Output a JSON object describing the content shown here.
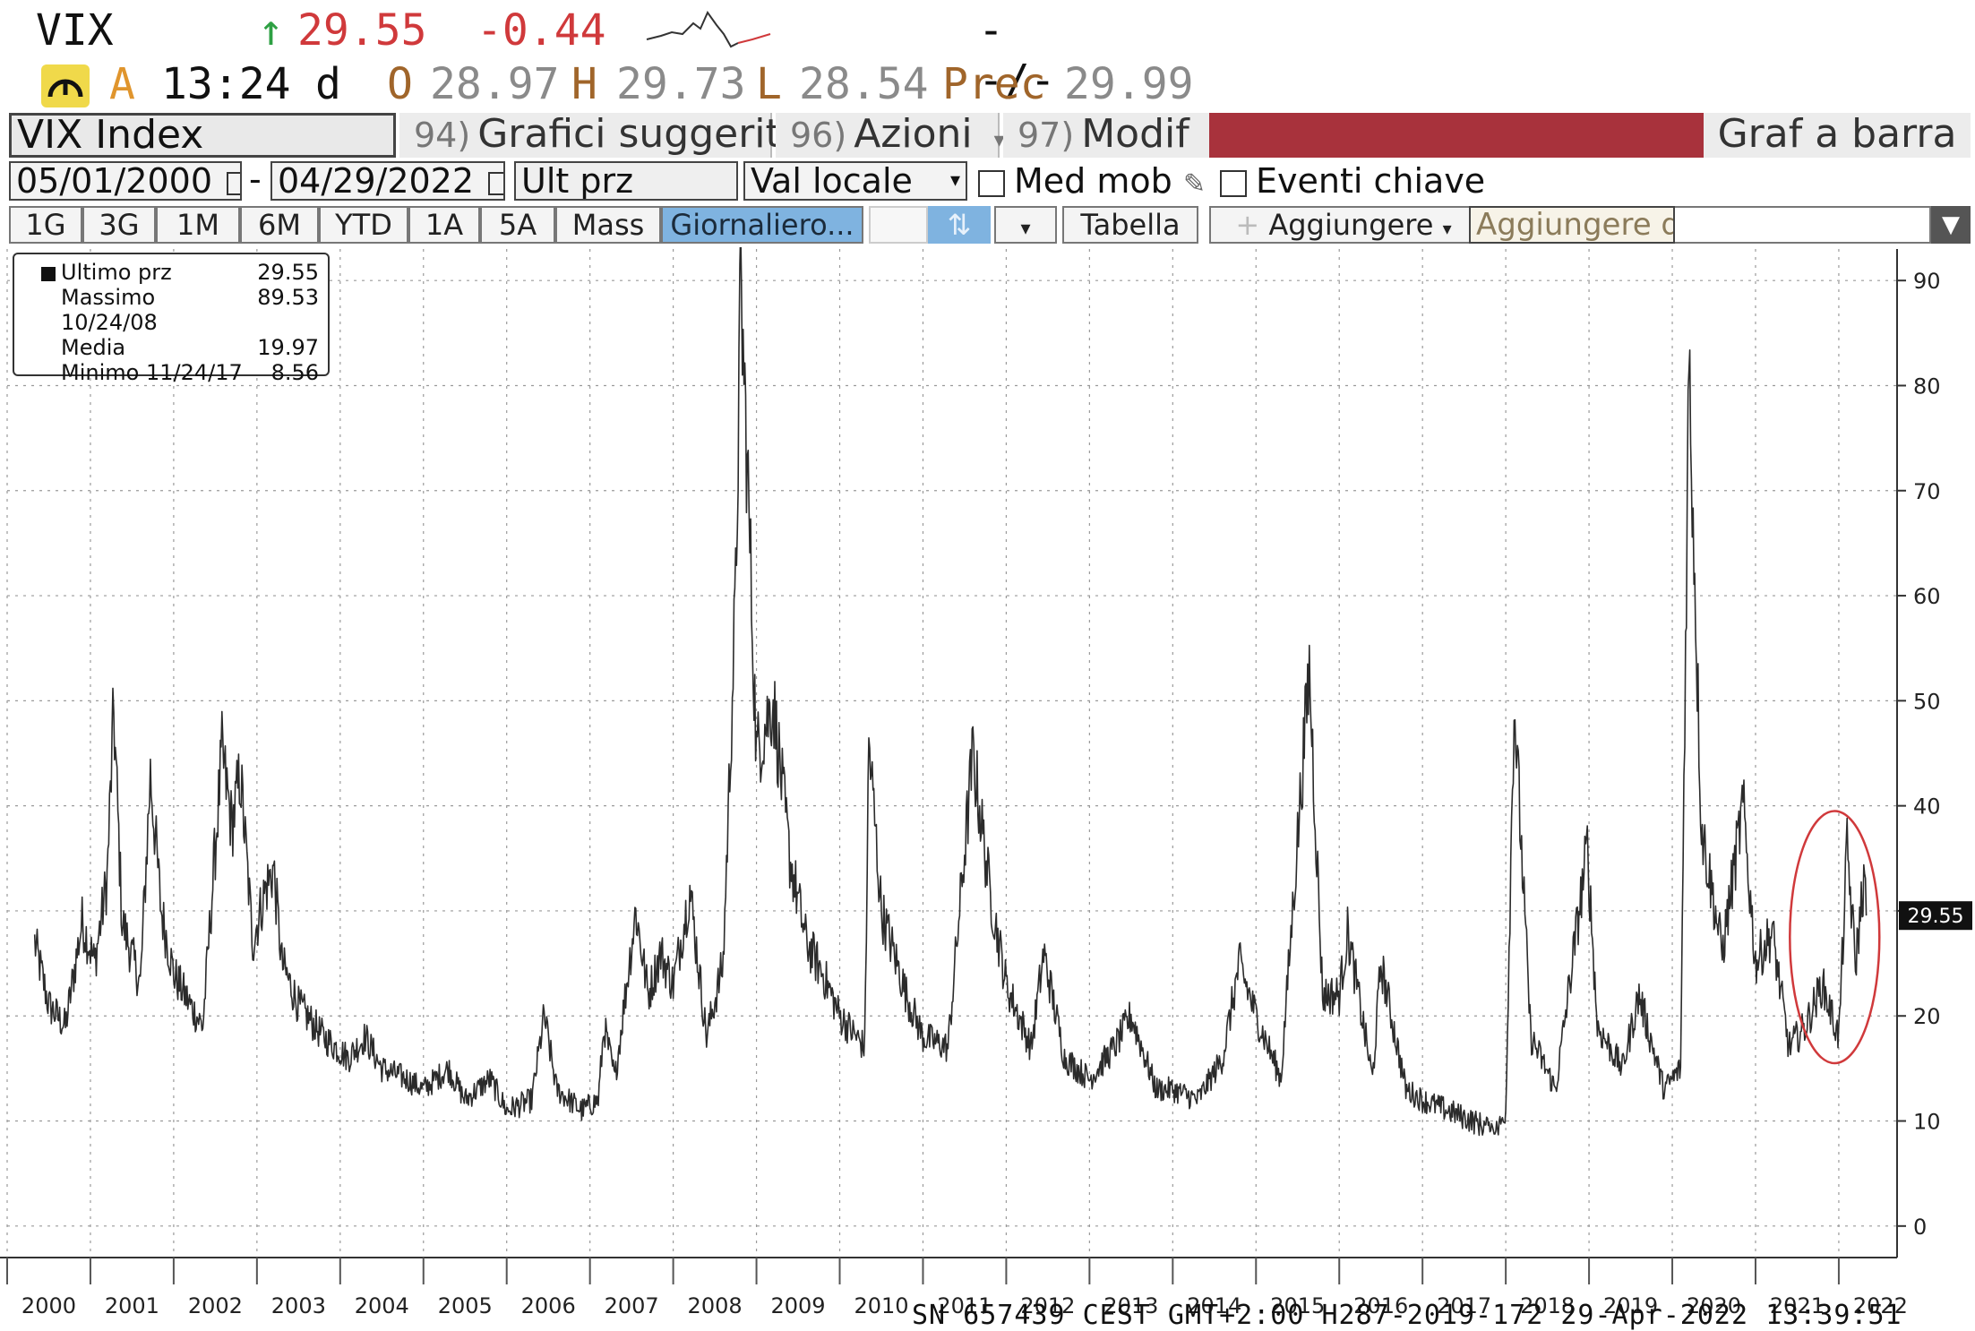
{
  "header": {
    "ticker": "VIX",
    "arrow": "↑",
    "last": "29.55",
    "change": "-0.44",
    "dash": "--/--",
    "quote_letter": "A",
    "time": "13:24",
    "time_suffix": "d",
    "open_label": "O",
    "open": "28.97",
    "high_label": "H",
    "high": "29.73",
    "low_label": "L",
    "low": "28.54",
    "prev_label": "Prec",
    "prev": "29.99"
  },
  "toolbar": {
    "security": "VIX Index",
    "tabs": [
      {
        "num": "94)",
        "label": "Grafici suggeriti"
      },
      {
        "num": "96)",
        "label": "Azioni",
        "arrow": "▾"
      },
      {
        "num": "97)",
        "label": "Modif",
        "arrow": "▾"
      }
    ],
    "chart_type": "Graf a barra",
    "start_date": "05/01/2000",
    "separator": "-",
    "end_date": "04/29/2022",
    "field": "Ult prz",
    "currency": "Val locale",
    "moving_avg": "Med mob",
    "key_events": "Eventi chiave",
    "periods": [
      "1G",
      "3G",
      "1M",
      "6M",
      "YTD",
      "1A",
      "5A",
      "Mass"
    ],
    "frequency": "Giornaliero...",
    "table": "Tabella",
    "add": "Aggiungere",
    "add_input": "Aggiungere d"
  },
  "legend": {
    "rows": [
      {
        "label": "Ultimo prz",
        "value": "29.55"
      },
      {
        "label": "Massimo 10/24/08",
        "value": "89.53"
      },
      {
        "label": "Media",
        "value": "19.97"
      },
      {
        "label": "Minimo 11/24/17",
        "value": "8.56"
      }
    ]
  },
  "footer": "SN 657439 CEST GMT+2:00 H287-2019-172 29-Apr-2022 13:39:51",
  "colors": {
    "accent_red": "#d0393b",
    "line": "#2b2b2b",
    "toolbar_red": "#a8323c",
    "selected": "#7fb3e0"
  },
  "chart_data": {
    "type": "line",
    "series": [
      {
        "name": "Ultimo prz",
        "points": [
          [
            2000.33,
            27
          ],
          [
            2000.5,
            21
          ],
          [
            2000.7,
            19
          ],
          [
            2000.9,
            29
          ],
          [
            2001.05,
            25
          ],
          [
            2001.2,
            33
          ],
          [
            2001.28,
            49
          ],
          [
            2001.38,
            29
          ],
          [
            2001.6,
            23
          ],
          [
            2001.72,
            43
          ],
          [
            2001.85,
            30
          ],
          [
            2002.0,
            24
          ],
          [
            2002.2,
            21
          ],
          [
            2002.35,
            19
          ],
          [
            2002.5,
            36
          ],
          [
            2002.58,
            45
          ],
          [
            2002.7,
            38
          ],
          [
            2002.8,
            43
          ],
          [
            2002.95,
            27
          ],
          [
            2003.1,
            32
          ],
          [
            2003.2,
            34
          ],
          [
            2003.3,
            25
          ],
          [
            2003.5,
            21
          ],
          [
            2003.8,
            18
          ],
          [
            2004.1,
            16
          ],
          [
            2004.3,
            18
          ],
          [
            2004.5,
            15
          ],
          [
            2004.8,
            14
          ],
          [
            2005.0,
            13
          ],
          [
            2005.3,
            15
          ],
          [
            2005.5,
            12
          ],
          [
            2005.8,
            14
          ],
          [
            2006.0,
            11
          ],
          [
            2006.3,
            12
          ],
          [
            2006.45,
            20
          ],
          [
            2006.6,
            13
          ],
          [
            2006.9,
            11
          ],
          [
            2007.1,
            12
          ],
          [
            2007.17,
            19
          ],
          [
            2007.3,
            14
          ],
          [
            2007.55,
            30
          ],
          [
            2007.7,
            22
          ],
          [
            2007.85,
            26
          ],
          [
            2008.0,
            23
          ],
          [
            2008.2,
            32
          ],
          [
            2008.4,
            18
          ],
          [
            2008.6,
            25
          ],
          [
            2008.75,
            60
          ],
          [
            2008.81,
            89.5
          ],
          [
            2008.9,
            70
          ],
          [
            2009.0,
            45
          ],
          [
            2009.2,
            50
          ],
          [
            2009.4,
            35
          ],
          [
            2009.6,
            27
          ],
          [
            2009.8,
            24
          ],
          [
            2010.0,
            20
          ],
          [
            2010.3,
            17
          ],
          [
            2010.35,
            46
          ],
          [
            2010.5,
            30
          ],
          [
            2010.8,
            22
          ],
          [
            2011.0,
            18
          ],
          [
            2011.3,
            17
          ],
          [
            2011.6,
            45
          ],
          [
            2011.8,
            32
          ],
          [
            2012.0,
            23
          ],
          [
            2012.3,
            17
          ],
          [
            2012.45,
            26
          ],
          [
            2012.7,
            16
          ],
          [
            2013.0,
            14
          ],
          [
            2013.3,
            17
          ],
          [
            2013.5,
            20
          ],
          [
            2013.8,
            13
          ],
          [
            2014.0,
            13
          ],
          [
            2014.3,
            12
          ],
          [
            2014.6,
            16
          ],
          [
            2014.8,
            25
          ],
          [
            2015.0,
            20
          ],
          [
            2015.3,
            14
          ],
          [
            2015.64,
            53
          ],
          [
            2015.8,
            22
          ],
          [
            2016.0,
            22
          ],
          [
            2016.1,
            28
          ],
          [
            2016.4,
            14
          ],
          [
            2016.5,
            25
          ],
          [
            2016.8,
            13
          ],
          [
            2017.0,
            12
          ],
          [
            2017.3,
            11
          ],
          [
            2017.6,
            10
          ],
          [
            2017.9,
            9
          ],
          [
            2018.0,
            11
          ],
          [
            2018.1,
            50
          ],
          [
            2018.3,
            18
          ],
          [
            2018.6,
            13
          ],
          [
            2018.98,
            36
          ],
          [
            2019.1,
            19
          ],
          [
            2019.4,
            15
          ],
          [
            2019.6,
            22
          ],
          [
            2019.9,
            13
          ],
          [
            2020.1,
            15
          ],
          [
            2020.2,
            82.7
          ],
          [
            2020.35,
            38
          ],
          [
            2020.6,
            26
          ],
          [
            2020.85,
            40
          ],
          [
            2021.0,
            25
          ],
          [
            2021.2,
            28
          ],
          [
            2021.4,
            17
          ],
          [
            2021.6,
            19
          ],
          [
            2021.8,
            23
          ],
          [
            2022.0,
            18
          ],
          [
            2022.1,
            36
          ],
          [
            2022.2,
            25
          ],
          [
            2022.3,
            33
          ],
          [
            2022.33,
            29.55
          ]
        ]
      }
    ],
    "xlim": [
      2000.0,
      2022.7
    ],
    "ylim": [
      -3,
      93
    ],
    "x_ticks": [
      "2000",
      "2001",
      "2002",
      "2003",
      "2004",
      "2005",
      "2006",
      "2007",
      "2008",
      "2009",
      "2010",
      "2011",
      "2012",
      "2013",
      "2014",
      "2015",
      "2016",
      "2017",
      "2018",
      "2019",
      "2020",
      "2021",
      "2022"
    ],
    "y_ticks": [
      0,
      10,
      20,
      30,
      40,
      50,
      60,
      70,
      80,
      90
    ],
    "last_label": "29.55",
    "grid": true,
    "legend_position": "top-left",
    "y_axis_position": "right",
    "annotation": "red ellipse around 2021-2022"
  }
}
